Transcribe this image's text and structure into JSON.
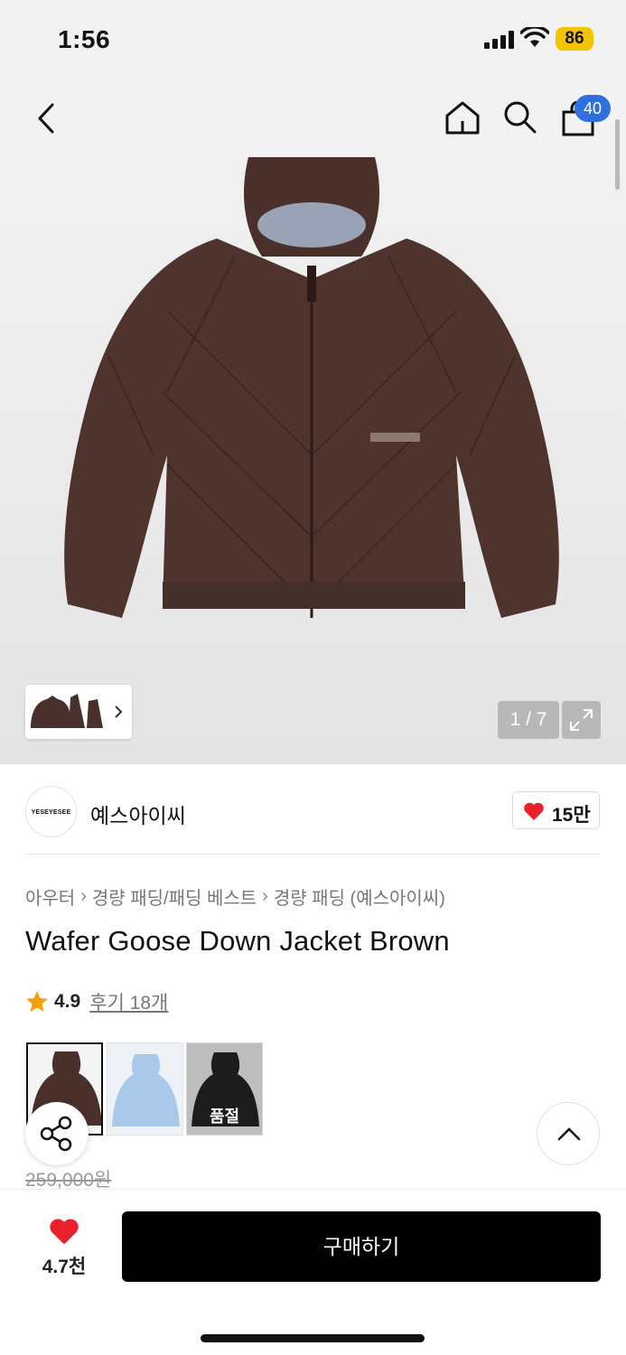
{
  "status_bar": {
    "time": "1:56",
    "battery": "86"
  },
  "nav": {
    "cart_count": "40"
  },
  "gallery": {
    "counter": "1 / 7"
  },
  "brand": {
    "logo_text": "YESEYESEE",
    "name": "예스아이씨",
    "likes": "15만"
  },
  "breadcrumb": [
    "아우터",
    "경량 패딩/패딩 베스트",
    "경량 패딩 (예스아이씨)"
  ],
  "product": {
    "title": "Wafer Goose Down Jacket Brown",
    "rating": "4.9",
    "reviews": "후기 18개",
    "price_original": "259,000원"
  },
  "swatches": [
    {
      "name": "Brown"
    },
    {
      "name": "Light Blue"
    },
    {
      "name": "Black",
      "badge": "품절"
    }
  ],
  "footer": {
    "wish_count": "4.7천",
    "buy_label": "구매하기"
  },
  "colors": {
    "accent_blue": "#2f6fe0",
    "heart_red": "#e8212b",
    "battery_yellow": "#f5c400",
    "jacket_brown": "#4a302b"
  }
}
